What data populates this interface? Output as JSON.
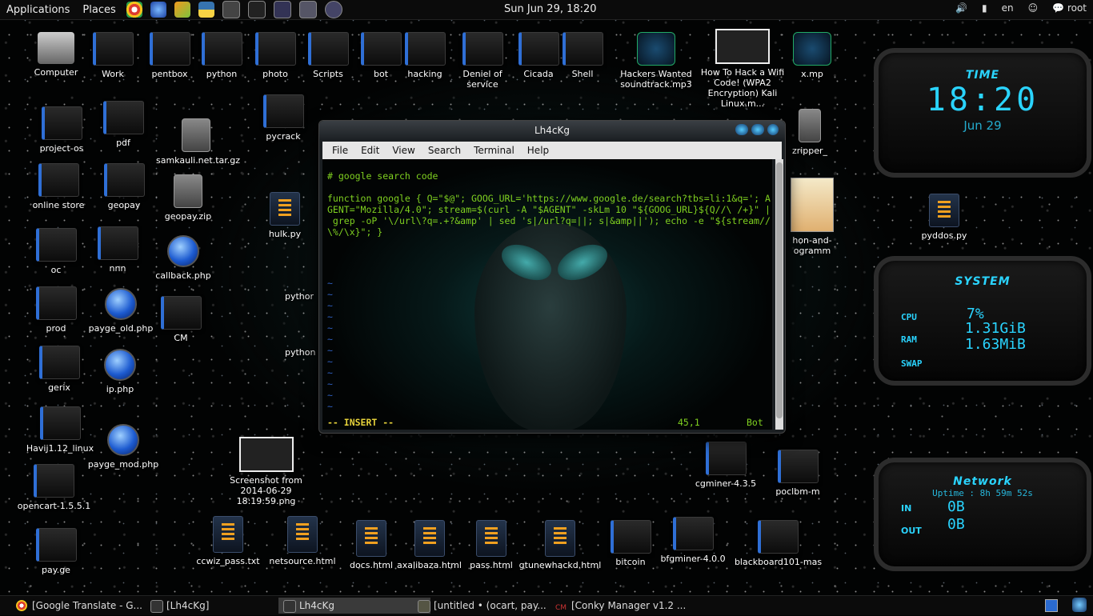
{
  "top_panel": {
    "applications": "Applications",
    "places": "Places",
    "clock": "Sun Jun 29, 18:20",
    "lang": "en",
    "user": "root",
    "launchers": [
      "chrome-icon",
      "globe-icon",
      "pencil-icon",
      "python-icon",
      "sublime-icon",
      "terminal-icon",
      "monitor-icon",
      "camera-icon",
      "screenshot-icon"
    ]
  },
  "desktop_icons": [
    {
      "label": "Computer",
      "kind": "computer"
    },
    {
      "label": "Work",
      "kind": "folder"
    },
    {
      "label": "pentbox",
      "kind": "folder"
    },
    {
      "label": "python",
      "kind": "folder"
    },
    {
      "label": "photo",
      "kind": "folder"
    },
    {
      "label": "Scripts",
      "kind": "folder"
    },
    {
      "label": "bot",
      "kind": "folder"
    },
    {
      "label": "hacking",
      "kind": "folder"
    },
    {
      "label": "Deniel of service",
      "kind": "folder"
    },
    {
      "label": "Cicada",
      "kind": "folder"
    },
    {
      "label": "Shell",
      "kind": "folder"
    },
    {
      "label": "Hackers Wanted soundtrack.mp3",
      "kind": "audio"
    },
    {
      "label": "How To Hack a Wifi Code! (WPA2 Encryption) Kali Linux.m...",
      "kind": "thumb"
    },
    {
      "label": "x.mp",
      "kind": "audio"
    },
    {
      "label": "project-os",
      "kind": "folder"
    },
    {
      "label": "pdf",
      "kind": "folder"
    },
    {
      "label": "samkauli.net.tar.gz",
      "kind": "zip"
    },
    {
      "label": "pycrack",
      "kind": "folder"
    },
    {
      "label": "zripper_",
      "kind": "zip"
    },
    {
      "label": "online store",
      "kind": "folder"
    },
    {
      "label": "geopay",
      "kind": "folder"
    },
    {
      "label": "geopay.zip",
      "kind": "zip"
    },
    {
      "label": "hulk.py",
      "kind": "script"
    },
    {
      "label": "hon-and-ogramm",
      "kind": "book"
    },
    {
      "label": "pyddos.py",
      "kind": "script"
    },
    {
      "label": "oc",
      "kind": "folder"
    },
    {
      "label": "nnn",
      "kind": "folder"
    },
    {
      "label": "callback.php",
      "kind": "globe"
    },
    {
      "label": "pythor",
      "kind": "none"
    },
    {
      "label": "prod",
      "kind": "folder"
    },
    {
      "label": "payge_old.php",
      "kind": "globe"
    },
    {
      "label": "CM",
      "kind": "folder"
    },
    {
      "label": "python",
      "kind": "none"
    },
    {
      "label": "gerix",
      "kind": "folder"
    },
    {
      "label": "ip.php",
      "kind": "globe"
    },
    {
      "label": "Havij1.12_linux",
      "kind": "folder"
    },
    {
      "label": "payge_mod.php",
      "kind": "globe"
    },
    {
      "label": "Screenshot from 2014-06-29 18:19:59.png",
      "kind": "thumb"
    },
    {
      "label": "opencart-1.5.5.1",
      "kind": "folder"
    },
    {
      "label": "cgminer-4.3.5",
      "kind": "folder"
    },
    {
      "label": "poclbm-m",
      "kind": "folder"
    },
    {
      "label": "pay.ge",
      "kind": "folder"
    },
    {
      "label": "ccwiz_pass.txt",
      "kind": "script"
    },
    {
      "label": "netsource.html",
      "kind": "script"
    },
    {
      "label": "docs.html",
      "kind": "script"
    },
    {
      "label": "axalibaza.html",
      "kind": "script"
    },
    {
      "label": "pass.html",
      "kind": "script"
    },
    {
      "label": "gtunewhackd.html",
      "kind": "script"
    },
    {
      "label": "bitcoin",
      "kind": "folder"
    },
    {
      "label": "bfgminer-4.0.0",
      "kind": "folder"
    },
    {
      "label": "blackboard101-mas",
      "kind": "folder"
    }
  ],
  "terminal": {
    "title": "Lh4cKg",
    "menu": [
      "File",
      "Edit",
      "View",
      "Search",
      "Terminal",
      "Help"
    ],
    "lines": [
      "# google search code",
      "",
      "function google { Q=\"$@\"; GOOG_URL='https://www.google.de/search?tbs=li:1&q='; A",
      "GENT=\"Mozilla/4.0\"; stream=$(curl -A \"$AGENT\" -skLm 10 \"${GOOG_URL}${Q//\\ /+}\" |",
      " grep -oP '\\/url\\?q=.+?&amp' | sed 's|/url?q=||; s|&amp||'); echo -e \"${stream//",
      "\\%/\\x}\"; }"
    ],
    "tilde": "~",
    "mode": "-- INSERT --",
    "position": "45,1",
    "scroll": "Bot"
  },
  "conky_time": {
    "title": "TIME",
    "time": "18:20",
    "date": "Jun 29"
  },
  "conky_system": {
    "title": "SYSTEM",
    "rows": [
      {
        "label": "CPU",
        "value": "7%"
      },
      {
        "label": "RAM",
        "value": "1.31GiB"
      },
      {
        "label": "SWAP",
        "value": "1.63MiB"
      }
    ]
  },
  "conky_network": {
    "title": "Network",
    "uptime": "Uptime : 8h 59m 52s",
    "in_label": "IN",
    "in_value": "0B",
    "out_label": "OUT",
    "out_value": "0B"
  },
  "taskbar": [
    {
      "label": "[Google Translate - G...",
      "active": false
    },
    {
      "label": "[Lh4cKg]",
      "active": false
    },
    {
      "label": "Lh4cKg",
      "active": true
    },
    {
      "label": "[untitled • (ocart, pay...",
      "active": false
    },
    {
      "label": "[Conky Manager v1.2 ...",
      "active": false
    }
  ],
  "colors": {
    "accent": "#2ad4ff",
    "vim_text": "#7fd020",
    "vim_tilde": "#2f60c0",
    "status_yellow": "#e6d23a"
  }
}
